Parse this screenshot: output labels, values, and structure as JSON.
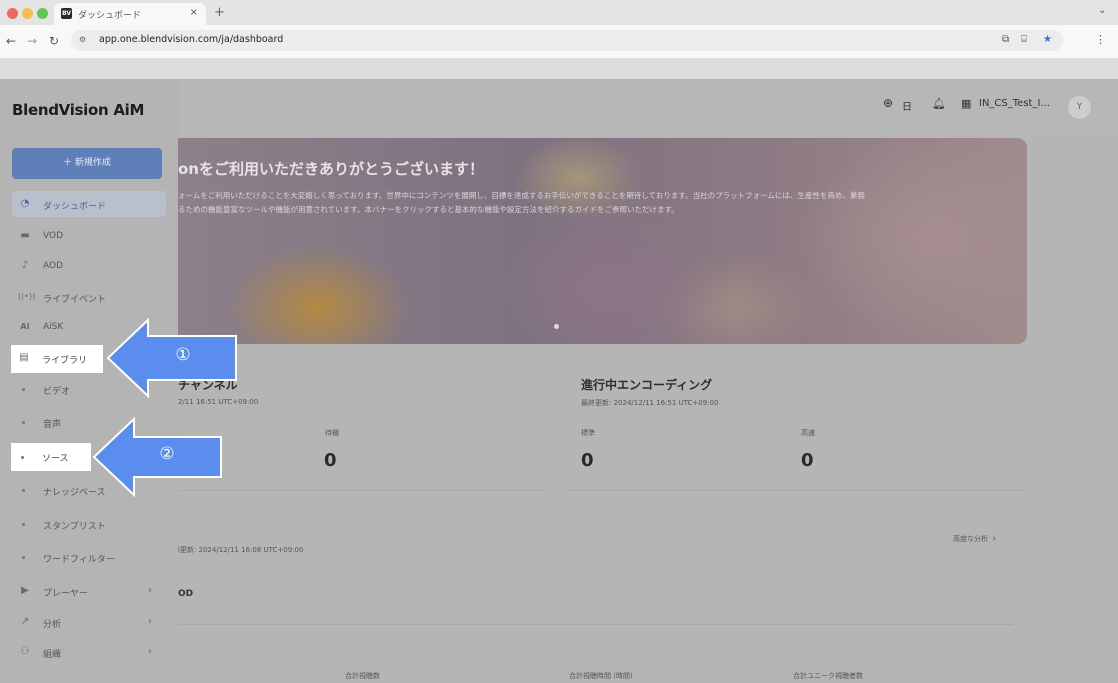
{
  "browser": {
    "tab_title": "ダッシュボード",
    "tab_favicon": "BV",
    "tab_close": "×",
    "new_tab": "+",
    "url": "app.one.blendvision.com/ja/dashboard",
    "tab_menu": "⌄"
  },
  "header": {
    "language": "日",
    "account": "IN_CS_Test_I...",
    "avatar": "Y"
  },
  "sidebar": {
    "logo": "BlendVision AiM",
    "new_button": "＋ 新規作成",
    "items": [
      {
        "label": "ダッシュボード",
        "icon": "dashboard-icon"
      },
      {
        "label": "VOD",
        "icon": "vod-icon"
      },
      {
        "label": "AOD",
        "icon": "music-note-icon"
      },
      {
        "label": "ライブイベント",
        "icon": "live-icon"
      },
      {
        "label": "AiSK",
        "icon": "ai-icon"
      },
      {
        "label": "ライブラリ",
        "icon": "library-icon"
      },
      {
        "label": "ビデオ"
      },
      {
        "label": "音声"
      },
      {
        "label": "ソース"
      },
      {
        "label": "ナレッジベース"
      },
      {
        "label": "スタンプリスト"
      },
      {
        "label": "ワードフィルター"
      },
      {
        "label": "プレーヤー",
        "icon": "player-icon"
      },
      {
        "label": "分析",
        "icon": "chart-icon"
      },
      {
        "label": "組織",
        "icon": "organization-icon"
      }
    ]
  },
  "banner": {
    "title": "onをご利用いただきありがとうございます！",
    "line1": "ォームをご利用いただけることを大変嬉しく思っております。世界中にコンテンツを展開し、目標を達成するお手伝いができることを期待しております。当社のプラットフォームには、生産性を高め、業務",
    "line2": "るための機能豊富なツールや機能が用意されています。本バナーをクリックすると基本的な機能や設定方法を紹介するガイドをご参照いただけます。"
  },
  "channels": {
    "title": "チャンネル",
    "updated": "2/11 16:51 UTC+09:00",
    "standby_label": "待機",
    "standby_value": "0"
  },
  "encoding": {
    "title": "進行中エンコーディング",
    "updated": "最終更新: 2024/12/11 16:51 UTC+09:00",
    "standard_label": "標準",
    "standard_value": "0",
    "fast_label": "高速",
    "fast_value": "0"
  },
  "analytics": {
    "updated": "l更新: 2024/12/11 16:08 UTC+09:00",
    "advanced_link": "高度な分析",
    "section_label": "OD",
    "col1": "合計視聴数",
    "col2": "合計視聴時間 (時間)",
    "col3": "合計ユニーク視聴者数"
  },
  "annotations": {
    "arrow1": "①",
    "arrow2": "②",
    "arrow_color": "#5b8def"
  }
}
